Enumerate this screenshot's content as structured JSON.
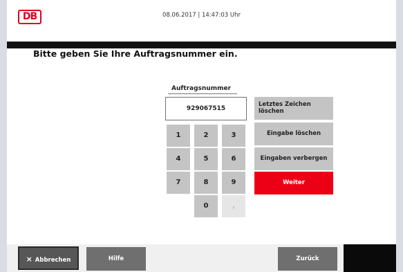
{
  "header": {
    "logo_text": "DB",
    "datetime": "08.06.2017 | 14:47:03 Uhr"
  },
  "main": {
    "headline": "Bitte geben Sie Ihre Auftragsnummer ein.",
    "field_label": "Auftragsnummer",
    "field_value": "929067515"
  },
  "keypad": {
    "keys": [
      "1",
      "2",
      "3",
      "4",
      "5",
      "6",
      "7",
      "8",
      "9",
      "0",
      ","
    ]
  },
  "actions": {
    "delete_last": "Letztes Zeichen löschen",
    "delete_last_line1": "Letztes Zeichen",
    "delete_last_line2": "löschen",
    "clear": "Eingabe löschen",
    "hide": "Eingaben verbergen",
    "next": "Weiter"
  },
  "footer": {
    "cancel_label": "Abbrechen",
    "cancel_icon": "×",
    "help_label": "Hilfe",
    "back_label": "Zurück"
  },
  "colors": {
    "brand_red": "#ec0016",
    "key_gray": "#c4c4c4",
    "footer_button_gray": "#6f6f6f"
  }
}
